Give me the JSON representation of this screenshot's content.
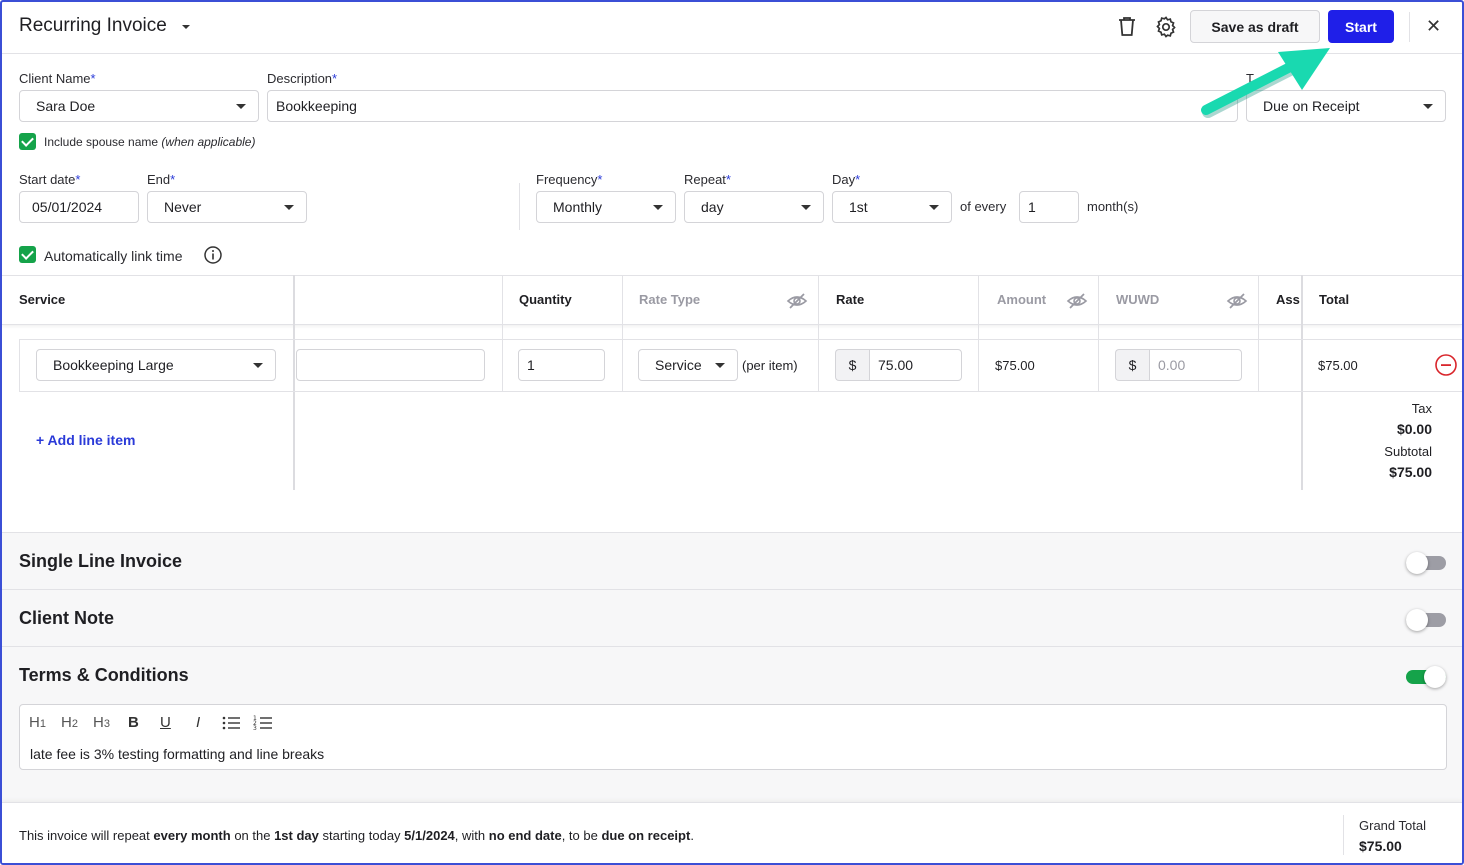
{
  "header": {
    "title": "Recurring Invoice",
    "save_draft_label": "Save as draft",
    "start_label": "Start",
    "close_glyph": "✕",
    "icons": [
      "trash-icon",
      "gear-icon",
      "close-icon"
    ]
  },
  "form": {
    "client_name_label": "Client Name",
    "client_name_value": "Sara Doe",
    "description_label": "Description",
    "description_value": "Bookkeeping",
    "terms_label_partial": "T",
    "terms_value": "Due on Receipt",
    "include_spouse_label": "Include spouse name",
    "include_spouse_hint": "(when applicable)",
    "include_spouse_checked": true,
    "start_date_label": "Start date",
    "start_date_value": "05/01/2024",
    "end_label": "End",
    "end_value": "Never",
    "frequency_label": "Frequency",
    "frequency_value": "Monthly",
    "repeat_label": "Repeat",
    "repeat_value": "day",
    "day_label": "Day",
    "day_value": "1st",
    "of_every_label": "of every",
    "of_every_value": "1",
    "months_label": "month(s)",
    "auto_link_label": "Automatically link time",
    "auto_link_checked": true,
    "required_mark": "*"
  },
  "table": {
    "headers": {
      "service": "Service",
      "quantity": "Quantity",
      "rate_type": "Rate Type",
      "rate": "Rate",
      "amount": "Amount",
      "wuwd": "WUWD",
      "ass": "Ass",
      "total": "Total"
    },
    "rows": [
      {
        "service": "Bookkeeping Large",
        "description": "",
        "quantity": "1",
        "rate_type": "Service",
        "rate_type_suffix": "(per item)",
        "rate_prefix": "$",
        "rate": "75.00",
        "amount": "$75.00",
        "wuwd_prefix": "$",
        "wuwd_placeholder": "0.00",
        "total": "$75.00"
      }
    ],
    "add_line_label": "+ Add line item",
    "tax_label": "Tax",
    "tax_value": "$0.00",
    "subtotal_label": "Subtotal",
    "subtotal_value": "$75.00"
  },
  "sections": {
    "single_line": {
      "title": "Single Line Invoice",
      "enabled": false
    },
    "client_note": {
      "title": "Client Note",
      "enabled": false
    },
    "terms": {
      "title": "Terms & Conditions",
      "enabled": true
    }
  },
  "editor": {
    "toolbar": [
      "H1",
      "H2",
      "H3",
      "B",
      "U",
      "I",
      "bullet-list",
      "numbered-list"
    ],
    "text": "late fee is 3% testing formatting and line breaks"
  },
  "footer": {
    "summary_parts": [
      {
        "t": "This invoice will repeat ",
        "b": false
      },
      {
        "t": "every month",
        "b": true
      },
      {
        "t": " on the ",
        "b": false
      },
      {
        "t": "1st day",
        "b": true
      },
      {
        "t": " starting today ",
        "b": false
      },
      {
        "t": "5/1/2024",
        "b": true
      },
      {
        "t": ", with ",
        "b": false
      },
      {
        "t": "no end date",
        "b": true
      },
      {
        "t": ", to be ",
        "b": false
      },
      {
        "t": "due on receipt",
        "b": true
      },
      {
        "t": ".",
        "b": false
      }
    ],
    "grand_total_label": "Grand Total",
    "grand_total_value": "$75.00"
  },
  "colors": {
    "primary": "#1f1fe8",
    "success": "#15a34a",
    "link": "#2a3ad8",
    "annotation_arrow": "#19d9b0",
    "danger": "#d9262c"
  }
}
